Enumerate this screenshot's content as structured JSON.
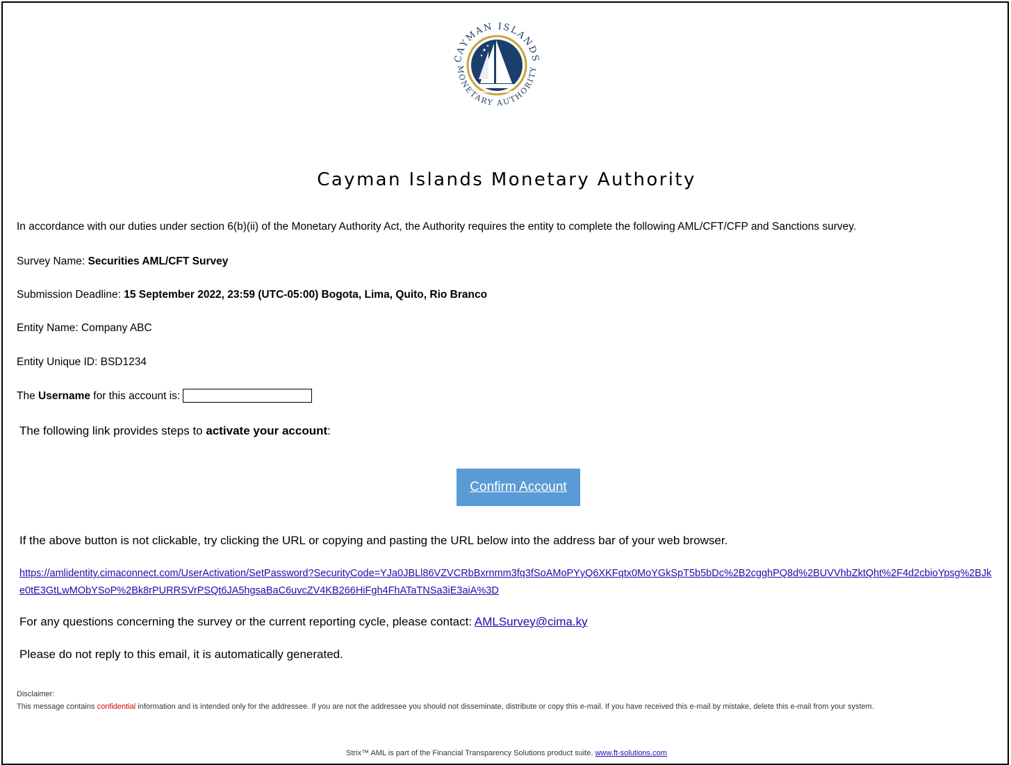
{
  "logo": {
    "top_text": "CAYMAN ISLANDS",
    "bottom_text": "MONETARY AUTHORITY",
    "navy": "#1b3f6b",
    "gold": "#c9a438"
  },
  "title": "Cayman Islands Monetary Authority",
  "intro": "In accordance with our duties under section 6(b)(ii) of the Monetary Authority Act, the Authority requires the entity to complete the following AML/CFT/CFP and Sanctions survey.",
  "survey": {
    "label": "Survey Name: ",
    "value": "Securities AML/CFT Survey"
  },
  "deadline": {
    "label": "Submission Deadline: ",
    "value": "15 September 2022, 23:59 (UTC-05:00) Bogota, Lima, Quito, Rio Branco"
  },
  "entity_name": "Entity Name: Company ABC",
  "entity_id": "Entity Unique ID: BSD1234",
  "username": {
    "prefix": "The ",
    "bold": "Username",
    "suffix": " for this account is:"
  },
  "activate": {
    "prefix": "The following link provides steps to ",
    "bold": "activate your account",
    "suffix": ":"
  },
  "confirm_button": {
    "label": "Confirm Account",
    "color": "#5b9bd5"
  },
  "not_clickable": "If the above button is not clickable, try clicking the URL or copying and pasting the URL below into the address bar of your web browser.",
  "activation_url": "https://amlidentity.cimaconnect.com/UserActivation/SetPassword?SecurityCode=YJa0JBLl86VZVCRbBxrnmm3fq3fSoAMoPYyQ6XKFqtx0MoYGkSpT5b5bDc%2B2cgghPQ8d%2BUVVhbZktQht%2F4d2cbioYpsg%2BJke0tE3GtLwMObYSoP%2Bk8rPURRSVrPSQt6JA5hgsaBaC6uvcZV4KB266HiFgh4FhATaTNSa3iE3aiA%3D",
  "questions": {
    "prefix": "For any questions concerning the survey or the current reporting cycle, please contact: ",
    "email": "AMLSurvey@cima.ky"
  },
  "no_reply": "Please do not reply to this email, it is automatically generated.",
  "disclaimer": {
    "heading": "Disclaimer:",
    "prefix": "This message contains ",
    "highlight": "confidential",
    "suffix": " information and is intended only for the addressee. If you are not the addressee you should not disseminate, distribute or copy this e-mail. If you have received this e-mail by mistake, delete this e-mail from your system.",
    "highlight_color": "#d00000"
  },
  "footer": {
    "prefix": "Strix™ AML is part of the Financial Transparency Solutions product suite. ",
    "link": "www.ft-solutions.com"
  }
}
